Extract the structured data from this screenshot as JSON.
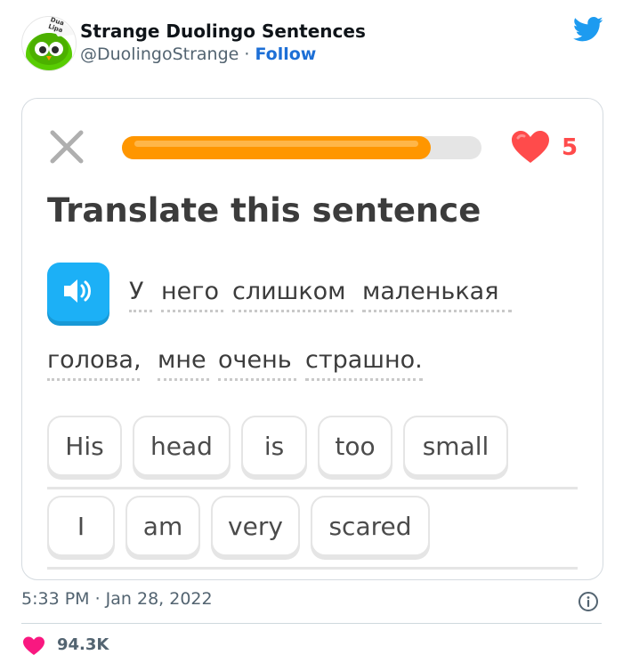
{
  "tweet": {
    "author_name": "Strange Duolingo Sentences",
    "handle": "@DuolingoStrange",
    "separator": " · ",
    "follow_label": "Follow",
    "timestamp": "5:33 PM · Jan 28, 2022",
    "likes": "94.3K",
    "avatar_text": "Dua Lipa"
  },
  "lesson": {
    "progress": 0.86,
    "hearts": "5",
    "prompt_title": "Translate this sentence",
    "sentence_words": [
      "У",
      "него",
      "слишком",
      "маленькая",
      "голова,",
      "мне",
      "очень",
      "страшно."
    ],
    "word_bank_row1": [
      "His",
      "head",
      "is",
      "too",
      "small"
    ],
    "word_bank_row2": [
      "I",
      "am",
      "very",
      "scared"
    ]
  },
  "colors": {
    "progress": "#ff9600",
    "heart": "#ff4b4b",
    "speaker": "#1cb0f6",
    "follow": "#1d6fd6",
    "twitter": "#1d9bf0",
    "like": "#f91880"
  },
  "icons": [
    "twitter-bird-icon",
    "close-icon",
    "heart-icon",
    "speaker-icon",
    "info-icon",
    "like-heart-icon"
  ]
}
